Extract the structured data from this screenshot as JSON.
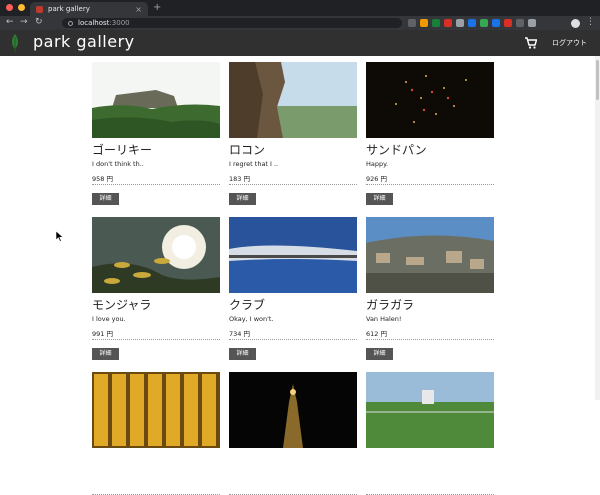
{
  "browser": {
    "tab_title": "park gallery",
    "tab_close": "×",
    "new_tab": "+",
    "url_host": "localhost",
    "url_port": ":3000",
    "back": "←",
    "forward": "→",
    "reload": "↻",
    "menu": "⋮",
    "extension_colors": [
      "#5f6368",
      "#f29900",
      "#188038",
      "#d93025",
      "#9aa0a6",
      "#1a73e8",
      "#34a853",
      "#1a73e8",
      "#d93025",
      "#5f6368",
      "#9aa0a6"
    ]
  },
  "header": {
    "brand": "park gallery",
    "logout": "ログアウト",
    "icons": [
      "leaf-icon",
      "cart-icon"
    ]
  },
  "cards": [
    {
      "name": "ゴーリキー",
      "desc": "I don't think th..",
      "price": "958 円",
      "detail": "詳細",
      "image": "rock-island-landscape"
    },
    {
      "name": "ロコン",
      "desc": "I regret that I ..",
      "price": "183 円",
      "detail": "詳細",
      "image": "cliff-valley"
    },
    {
      "name": "サンドパン",
      "desc": "Happy.",
      "price": "926 円",
      "detail": "詳細",
      "image": "fireworks-night"
    },
    {
      "name": "モンジャラ",
      "desc": "I love you.",
      "price": "991 円",
      "detail": "詳細",
      "image": "sun-through-leaves"
    },
    {
      "name": "クラブ",
      "desc": "Okay, I won't.",
      "price": "734 円",
      "detail": "詳細",
      "image": "sea-horizon-reflection"
    },
    {
      "name": "ガラガラ",
      "desc": "Van Halen!",
      "price": "612 円",
      "detail": "詳細",
      "image": "hillside-town"
    },
    {
      "name": "",
      "desc": "",
      "price": "",
      "detail": "",
      "image": "golden-panels"
    },
    {
      "name": "",
      "desc": "",
      "price": "",
      "detail": "",
      "image": "night-tower"
    },
    {
      "name": "",
      "desc": "",
      "price": "",
      "detail": "",
      "image": "sports-field"
    }
  ]
}
